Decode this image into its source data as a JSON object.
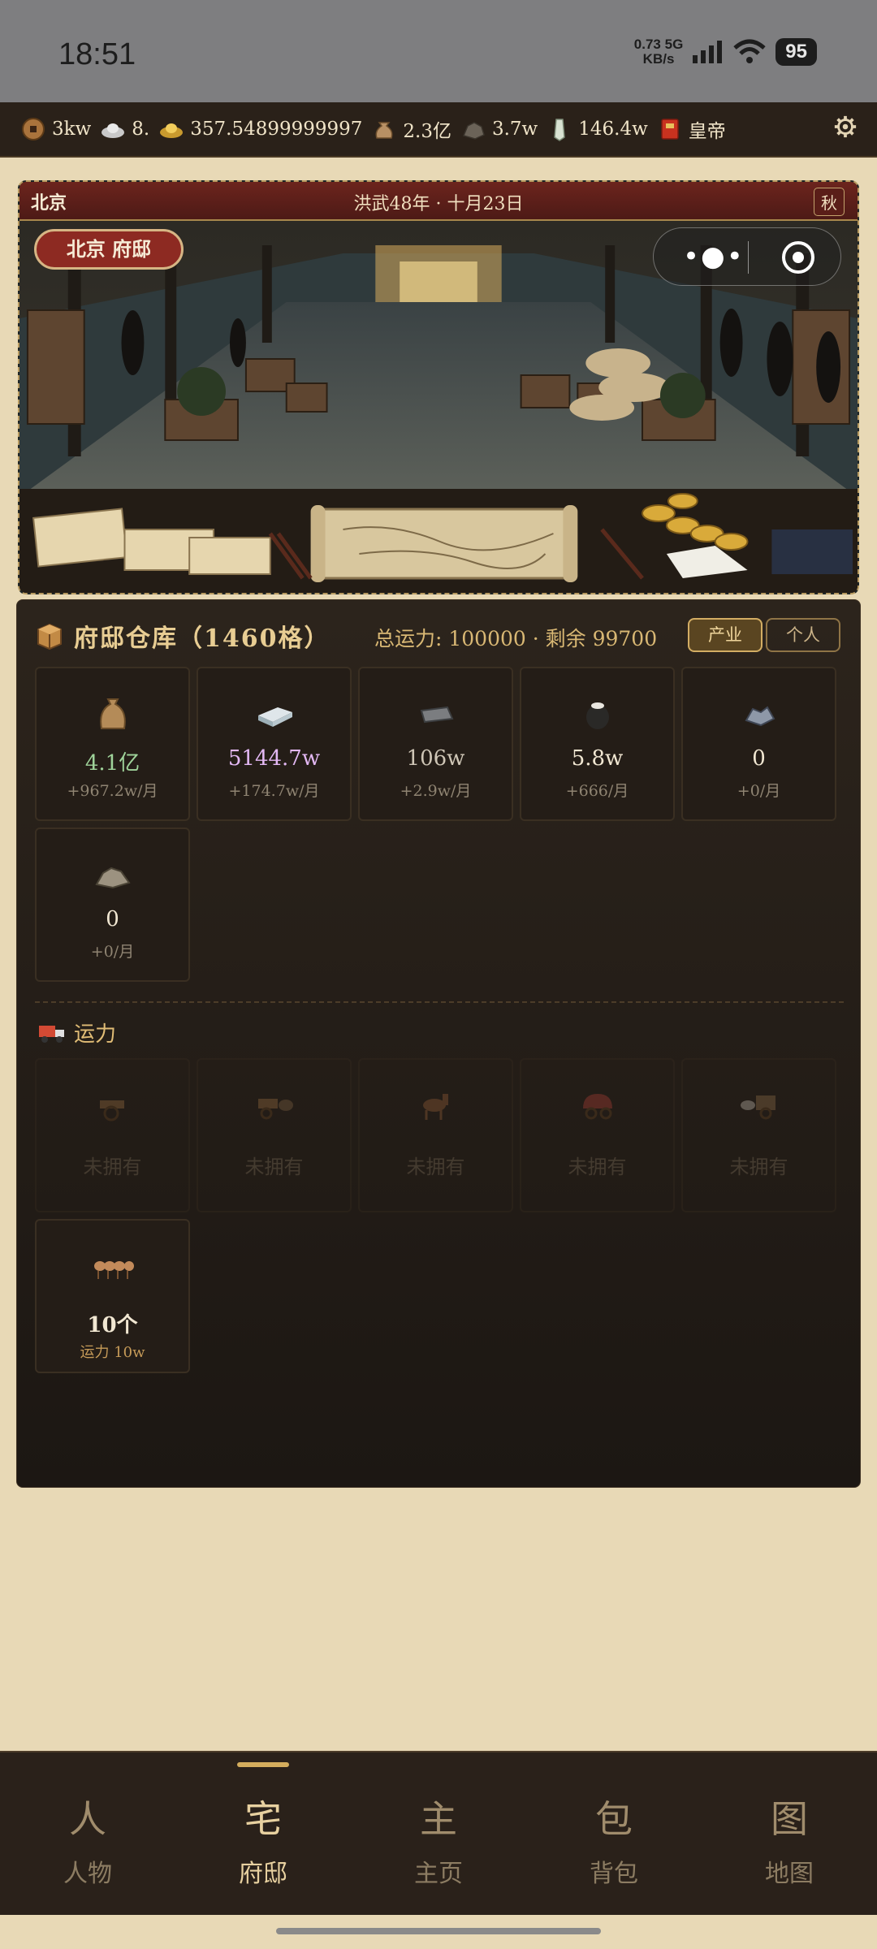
{
  "status_bar": {
    "time": "18:51",
    "net_speed": "0.73",
    "net_unit": "KB/s",
    "net_type": "5G",
    "battery": "95"
  },
  "resources": [
    {
      "icon": "copper-coin-icon",
      "value": "3kw"
    },
    {
      "icon": "silver-ingot-icon",
      "value": "8."
    },
    {
      "icon": "gold-ingot-icon",
      "value": "357.54899999997"
    },
    {
      "icon": "money-bag-icon",
      "value": "2.3亿"
    },
    {
      "icon": "ore-icon",
      "value": "3.7w"
    },
    {
      "icon": "jade-icon",
      "value": "146.4w"
    },
    {
      "icon": "imperial-book-icon",
      "value": "皇帝"
    }
  ],
  "scene": {
    "city": "北京",
    "date": "洪武48年 · 十月23日",
    "season": "秋",
    "location_button": "北京 府邸"
  },
  "warehouse": {
    "title": "府邸仓库（1460格）",
    "capacity": "总运力: 100000 · 剩余 99700",
    "tabs": [
      "产业",
      "个人"
    ],
    "items": [
      {
        "icon": "grain-sack-icon",
        "value": "4.1亿",
        "rate": "+967.2w/月",
        "color": "#9fd39a"
      },
      {
        "icon": "silver-bars-icon",
        "value": "5144.7w",
        "rate": "+174.7w/月",
        "color": "#e3b8f4"
      },
      {
        "icon": "iron-ingot-icon",
        "value": "106w",
        "rate": "+2.9w/月",
        "color": "#cfc6b6"
      },
      {
        "icon": "salt-jar-icon",
        "value": "5.8w",
        "rate": "+666/月",
        "color": "#f1e7d2"
      },
      {
        "icon": "gemstone-icon",
        "value": "0",
        "rate": "+0/月",
        "color": "#f1e7d2"
      },
      {
        "icon": "ore-pile-icon",
        "value": "0",
        "rate": "+0/月",
        "color": "#f1e7d2"
      }
    ]
  },
  "transport": {
    "title": "运力",
    "vehicles": [
      {
        "icon": "handcart-icon",
        "label": "未拥有"
      },
      {
        "icon": "ox-cart-icon",
        "label": "未拥有"
      },
      {
        "icon": "horse-icon",
        "label": "未拥有"
      },
      {
        "icon": "covered-wagon-icon",
        "label": "未拥有"
      },
      {
        "icon": "horse-carriage-icon",
        "label": "未拥有"
      },
      {
        "icon": "camel-caravan-icon",
        "label": "10个",
        "sub": "运力 10w"
      }
    ]
  },
  "nav": [
    {
      "big": "人",
      "small": "人物"
    },
    {
      "big": "宅",
      "small": "府邸"
    },
    {
      "big": "主",
      "small": "主页"
    },
    {
      "big": "包",
      "small": "背包"
    },
    {
      "big": "图",
      "small": "地图"
    }
  ]
}
